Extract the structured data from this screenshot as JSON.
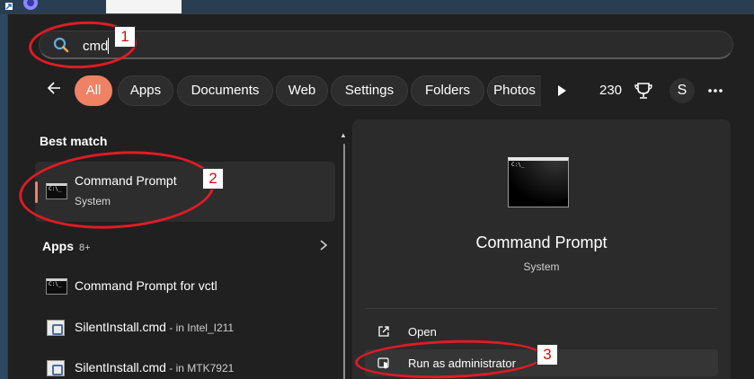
{
  "search": {
    "value": "cmd"
  },
  "filters": {
    "chips": [
      "All",
      "Apps",
      "Documents",
      "Web",
      "Settings",
      "Folders",
      "Photos"
    ],
    "active": "All",
    "points": "230",
    "avatar_initial": "S"
  },
  "best_match": {
    "heading": "Best match",
    "title": "Command Prompt",
    "subtitle": "System",
    "icon_text": "C:\\_"
  },
  "apps": {
    "heading": "Apps",
    "count": "8+",
    "items": [
      {
        "label": "Command Prompt for vctl",
        "suffix": "",
        "icon": "cmd-icon"
      },
      {
        "label": "SilentInstall.cmd",
        "suffix": " - in Intel_I211",
        "icon": "script-file-icon"
      },
      {
        "label": "SilentInstall.cmd",
        "suffix": " - in MTK7921",
        "icon": "script-file-icon"
      }
    ]
  },
  "preview": {
    "title": "Command Prompt",
    "subtitle": "System",
    "actions": [
      {
        "label": "Open",
        "icon": "open-external-icon"
      },
      {
        "label": "Run as administrator",
        "icon": "shield-admin-icon"
      }
    ]
  },
  "annotations": [
    "1",
    "2",
    "3"
  ],
  "colors": {
    "accent": "#ef8164",
    "annotation": "#e01b24",
    "panel": "#202020"
  }
}
